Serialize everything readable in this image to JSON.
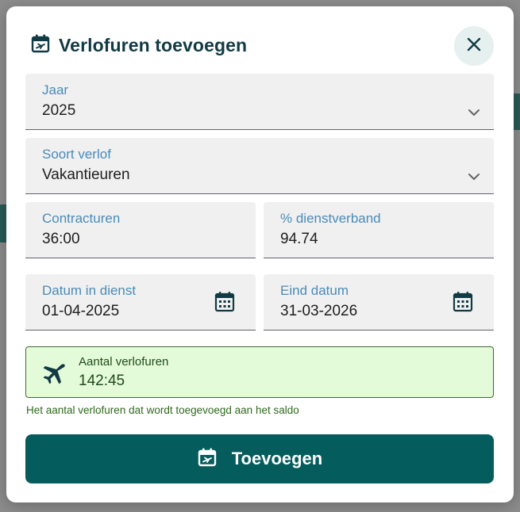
{
  "dialog": {
    "title": "Verlofuren toevoegen",
    "icons": {
      "title": "calendar-plane-icon",
      "close": "close-icon"
    }
  },
  "fields": {
    "year": {
      "label": "Jaar",
      "value": "2025"
    },
    "leave_type": {
      "label": "Soort verlof",
      "value": "Vakantieuren"
    },
    "contract_hours": {
      "label": "Contracturen",
      "value": "36:00"
    },
    "employment_pct": {
      "label": "% dienstverband",
      "value": "94.74"
    },
    "start_date": {
      "label": "Datum in dienst",
      "value": "01-04-2025"
    },
    "end_date": {
      "label": "Eind datum",
      "value": "31-03-2026"
    }
  },
  "summary": {
    "label": "Aantal verlofuren",
    "value": "142:45",
    "hint": "Het aantal verlofuren dat wordt toegevoegd aan het saldo",
    "icon": "airplane-icon"
  },
  "submit": {
    "label": "Toevoegen",
    "icon": "calendar-plane-icon"
  },
  "colors": {
    "primary": "#055c5d",
    "label_blue": "#4a8bb8",
    "success_bg": "#e4fbd9",
    "success_text": "#1f4a1c",
    "title": "#123a44"
  }
}
